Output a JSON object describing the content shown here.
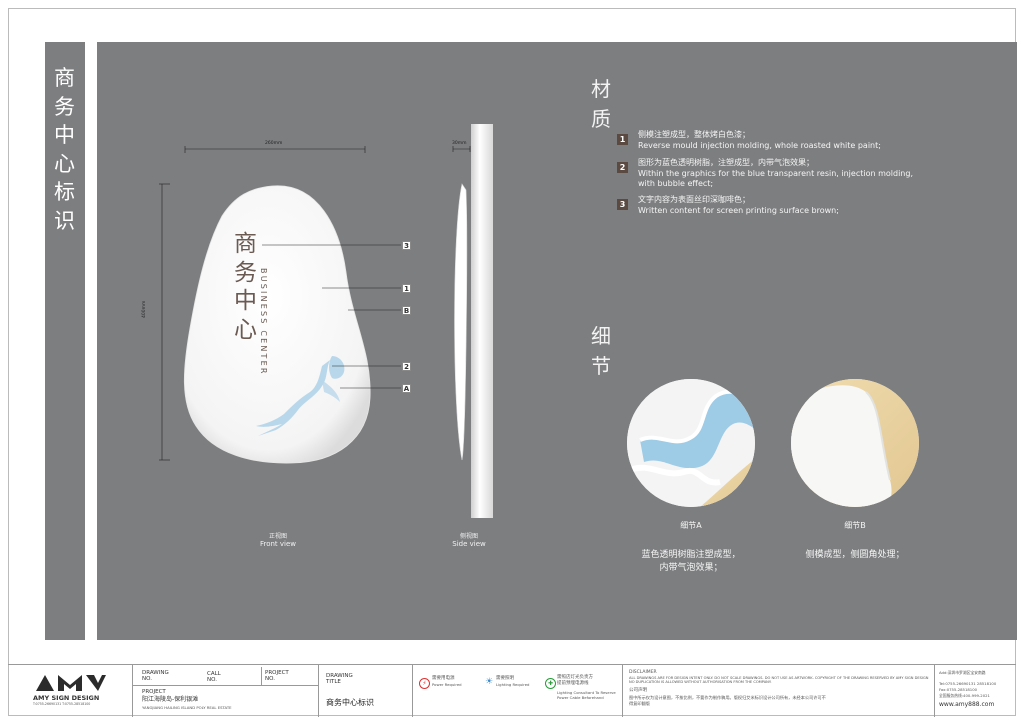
{
  "sidebar_title": [
    "商",
    "务",
    "中",
    "心",
    "标",
    "识"
  ],
  "front_view": {
    "width_dim": "260mm",
    "height_dim": "400mm",
    "sign_cn": [
      "商",
      "务",
      "中",
      "心"
    ],
    "sign_en": "BUSINESS CENTER",
    "callouts": [
      "3",
      "1",
      "B",
      "2",
      "A"
    ],
    "caption_cn": "正视图",
    "caption_en": "Front view"
  },
  "side_view": {
    "depth_dim": "30mm",
    "caption_cn": "侧视图",
    "caption_en": "Side view"
  },
  "materials": {
    "heading": [
      "材",
      "质"
    ],
    "items": [
      {
        "num": "1",
        "cn": "侧模注塑成型，整体烤白色漆；",
        "en": "Reverse mould injection molding, whole roasted white paint;"
      },
      {
        "num": "2",
        "cn": "图形为蓝色透明树脂，注塑成型，内带气泡效果；",
        "en": "Within the graphics for the blue transparent resin, injection molding,",
        "en2": "with bubble effect;"
      },
      {
        "num": "3",
        "cn": "文字内容为表面丝印深咖啡色；",
        "en": "Written content for screen printing surface brown;"
      }
    ]
  },
  "details": {
    "heading": [
      "细",
      "节"
    ],
    "a": {
      "label": "细节A",
      "desc1": "蓝色透明树脂注塑成型，",
      "desc2": "内带气泡效果；"
    },
    "b": {
      "label": "细节B",
      "desc1": "侧模成型，侧圆角处理；"
    }
  },
  "title_block": {
    "logo": "AMY",
    "company": "AMY SIGN DESIGN",
    "company_phone": "T:0755-26690131  T:0755-28518100",
    "drawing_no": "DRAWING\nNO.",
    "call_no": "CALL\nNO.",
    "project_no": "PROJECT\nNO.",
    "project_label": "PROJECT",
    "project_cn": "阳江海陵岛-保利银滩",
    "project_en": "YANGJIANG HAILING ISLAND POLY REAL ESTATE",
    "drawing_title_label": "DRAWING\nTITLE",
    "drawing_title": "商务中心标识",
    "power_cn": "需要用电源",
    "power_en": "Power Required",
    "lighting_cn": "需要照明",
    "lighting_en": "Lighting Required",
    "consultant_cn": "需照店灯光负责方",
    "consultant_cn2": "提前预埋电源线",
    "consultant_en": "Lighting Consultant To Reserve",
    "consultant_en2": "Power Cable Beforehand",
    "disclaimer_label": "DISCLAIMER",
    "disclaimer_text": "ALL DRAWINGS ARE FOR DESIGN INTENT ONLY. DO NOT SCALE DRAWINGS. DO NOT USE AS ARTWORK. COPYRIGHT OF THE DRAWING RESERVED BY AMY SIGN DESIGN NO DUPLICATION IS ALLOWED WITHOUT AUTHORISATION FROM THE COMPANY.",
    "disclaimer_cn_label": "公司声明",
    "disclaimer_cn": "图中所示仅为设计意图，不按比例，不要作为制作稿用。版权归艾米标识设计公司所有，未经本公司许可不得复印翻版",
    "address": "Add:深圳市罗湖区宝安南路",
    "tel": "Tel:0755-26690131  28518100",
    "fax": "Fax:0755-28518100",
    "hotline": "全国服务热线:400-999-2021",
    "website": "www.amy888.com"
  }
}
